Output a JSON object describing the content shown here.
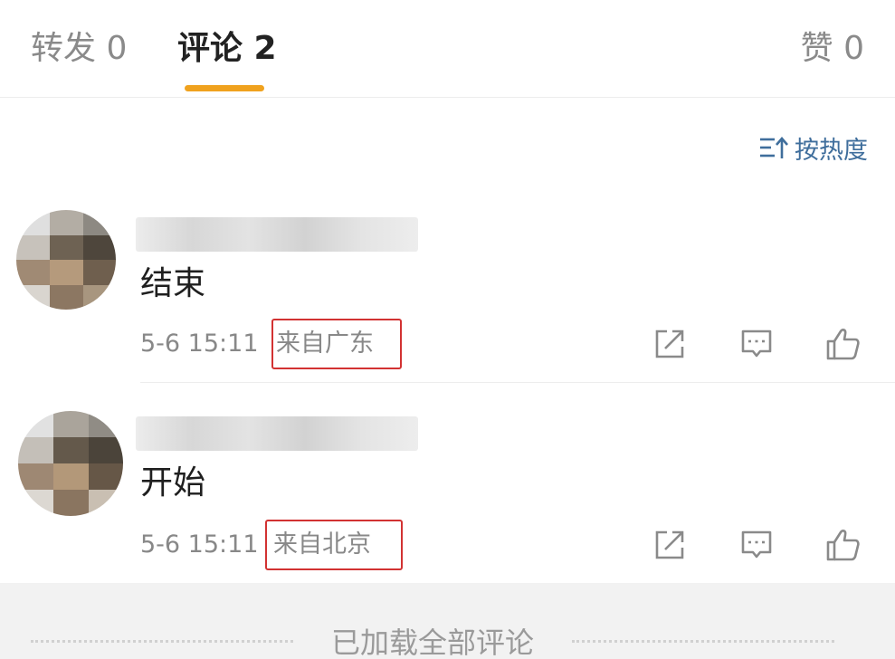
{
  "tabs": {
    "repost": "转发 0",
    "comment": "评论 2",
    "like": "赞 0"
  },
  "sort": {
    "label": "按热度",
    "icon": "sort-icon"
  },
  "comments": [
    {
      "text": "结束",
      "time": "5-6 15:11",
      "location": "来自广东",
      "actions": [
        "share-icon",
        "reply-icon",
        "like-icon"
      ]
    },
    {
      "text": "开始",
      "time": "5-6 15:11",
      "location": "来自北京",
      "actions": [
        "share-icon",
        "reply-icon",
        "like-icon"
      ]
    }
  ],
  "footer": {
    "text": "已加载全部评论"
  },
  "colors": {
    "accent": "#f0a21e",
    "link": "#3f6e9c",
    "highlight_box": "#d23232",
    "muted": "#888888"
  }
}
